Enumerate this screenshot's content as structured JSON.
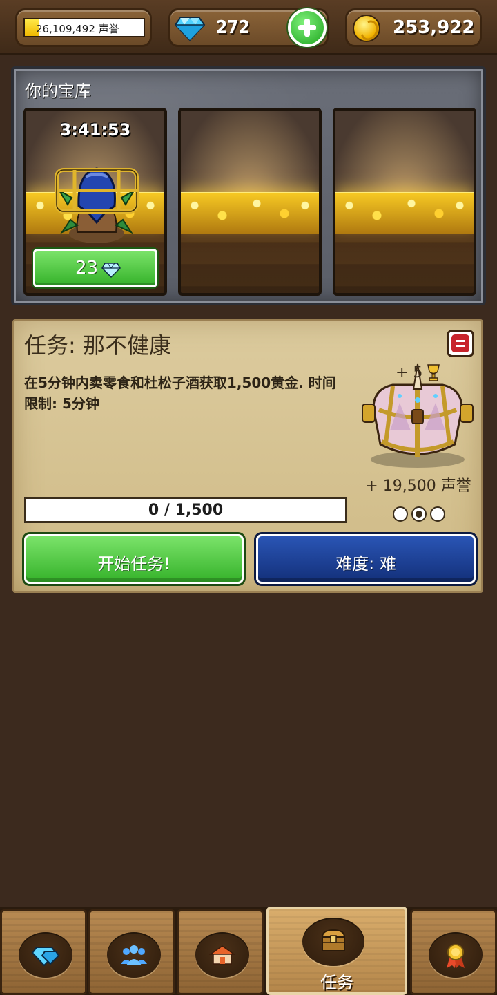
{
  "topbar": {
    "reputation": {
      "text": "26,109,492 声誉",
      "fill_fraction": 0.12
    },
    "gems": {
      "count": "272"
    },
    "gold": {
      "count": "253,922"
    }
  },
  "vault": {
    "title": "你的宝库",
    "slots": [
      {
        "timer": "3:41:53",
        "speedup_cost": "23",
        "state": "opening"
      },
      {
        "state": "empty"
      },
      {
        "state": "empty"
      }
    ]
  },
  "quest": {
    "title": "任务: 那不健康",
    "description": "在5分钟内卖零食和杜松子酒获取1,500黄金. 时间限制: 5分钟",
    "reward_trophies": "+ 5",
    "reward_reputation": "+ 19,500 声誉",
    "difficulty_stars": 3,
    "difficulty_stars_filled": 1,
    "progress_text": "0 / 1,500",
    "progress_fraction": 0,
    "start_button": "开始任务!",
    "difficulty_button": "难度: 难"
  },
  "nav": {
    "tabs": [
      {
        "id": "gems",
        "label": "",
        "icon": "gem-icon"
      },
      {
        "id": "staff",
        "label": "",
        "icon": "people-icon"
      },
      {
        "id": "tavern",
        "label": "",
        "icon": "tavern-icon"
      },
      {
        "id": "quests",
        "label": "任务",
        "icon": "treasure-chest-icon",
        "active": true
      },
      {
        "id": "achievements",
        "label": "",
        "icon": "medal-icon"
      }
    ]
  },
  "colors": {
    "green_button": "#35b22a",
    "blue_button": "#13307a",
    "panel_parchment": "#dccb9e",
    "background": "#3c2a1e"
  }
}
